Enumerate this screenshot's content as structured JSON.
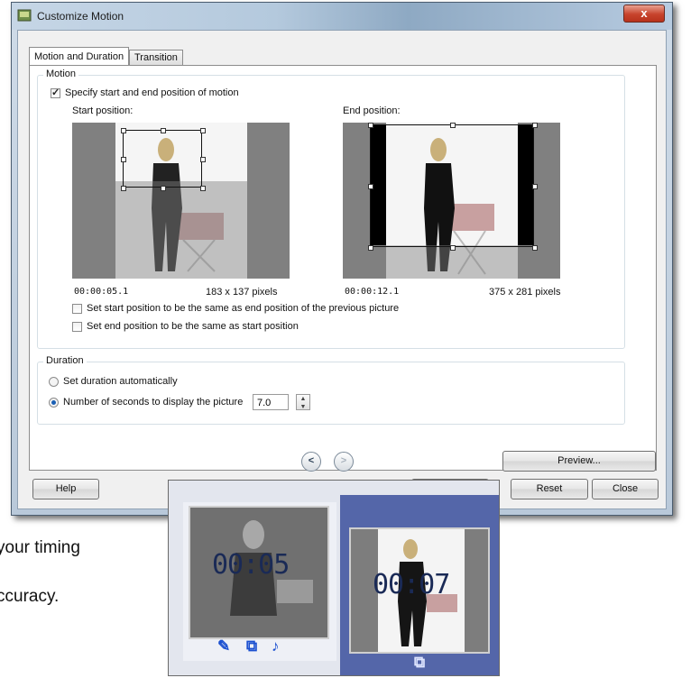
{
  "background": {
    "line1": "your timing",
    "line2": "ccuracy."
  },
  "window": {
    "title": "Customize Motion",
    "close_label": "x",
    "tabs": [
      "Motion and Duration",
      "Transition"
    ],
    "motion_group": {
      "title": "Motion",
      "specify_label": "Specify start and end position of motion",
      "start_label": "Start position:",
      "end_label": "End position:",
      "start_time": "00:00:05.1",
      "start_size": "183 x 137 pixels",
      "end_time": "00:00:12.1",
      "end_size": "375 x 281 pixels",
      "option_start_same": "Set start position to be the same as end position of the previous picture",
      "option_end_same": "Set end position to be the same as start position"
    },
    "duration_group": {
      "title": "Duration",
      "auto_label": "Set duration automatically",
      "seconds_label": "Number of seconds to display the picture",
      "seconds_value": "7.0"
    },
    "nav": {
      "prev": "<",
      "next": ">"
    },
    "buttons": {
      "preview": "Preview...",
      "help": "Help",
      "reset": "Reset",
      "close": "Close"
    }
  },
  "storyboard": {
    "clip1_time": "00:05",
    "clip2_time": "00:07"
  },
  "colors": {
    "accent": "#1a5fb4",
    "storyboard_selected": "#5466a9"
  }
}
